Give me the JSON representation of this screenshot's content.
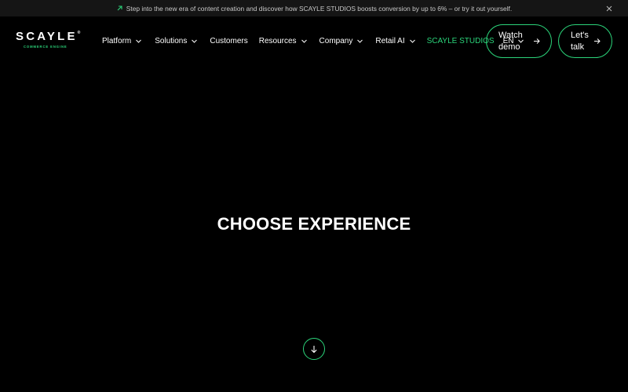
{
  "announcement": {
    "text": "Step into the new era of content creation and discover how SCAYLE STUDIOS boosts conversion by up to 6% – or try it out yourself.",
    "icon": "arrow-up-right-icon",
    "close_icon": "close-icon"
  },
  "logo": {
    "word": "SCAYLE",
    "registered": "®",
    "tagline": "COMMERCE ENGINE"
  },
  "nav": {
    "items": [
      {
        "label": "Platform",
        "dropdown": true
      },
      {
        "label": "Solutions",
        "dropdown": true
      },
      {
        "label": "Customers",
        "dropdown": false
      },
      {
        "label": "Resources",
        "dropdown": true
      },
      {
        "label": "Company",
        "dropdown": true
      },
      {
        "label": "Retail AI",
        "dropdown": true
      },
      {
        "label": "SCAYLE STUDIOS",
        "dropdown": false
      },
      {
        "label": "EN",
        "dropdown": true
      }
    ]
  },
  "cta": {
    "watch_demo_line1": "Watch",
    "watch_demo_line2": "demo",
    "lets_talk_line1": "Let's",
    "lets_talk_line2": "talk"
  },
  "hero": {
    "title": "CHOOSE EXPERIENCE",
    "scroll_icon": "arrow-down-icon"
  },
  "colors": {
    "accent": "#2bd47a",
    "background": "#000000",
    "announcement_bg": "#151515"
  }
}
